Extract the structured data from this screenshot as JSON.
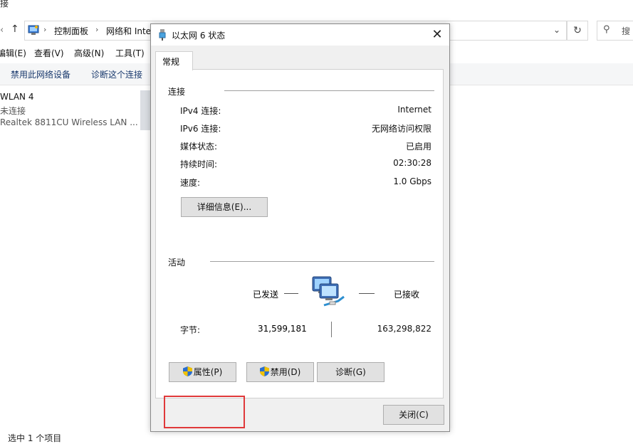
{
  "explorer": {
    "title_fragment": "接",
    "breadcrumb": [
      "控制面板",
      "网络和 Inte"
    ],
    "search_placeholder": "搜",
    "menu": [
      "编辑(E)",
      "查看(V)",
      "高级(N)",
      "工具(T)"
    ],
    "commands": [
      "禁用此网络设备",
      "诊断这个连接"
    ],
    "adapter": {
      "name": "WLAN 4",
      "status": "未连接",
      "description": "Realtek 8811CU Wireless LAN ..."
    },
    "status_bar": "选中 1 个项目"
  },
  "dialog": {
    "title": "以太网 6 状态",
    "tab": "常规",
    "connection": {
      "label": "连接",
      "rows": [
        {
          "label": "IPv4 连接:",
          "value": "Internet"
        },
        {
          "label": "IPv6 连接:",
          "value": "无网络访问权限"
        },
        {
          "label": "媒体状态:",
          "value": "已启用"
        },
        {
          "label": "持续时间:",
          "value": "02:30:28"
        },
        {
          "label": "速度:",
          "value": "1.0 Gbps"
        }
      ],
      "details_button": "详细信息(E)..."
    },
    "activity": {
      "label": "活动",
      "sent_label": "已发送",
      "received_label": "已接收",
      "bytes_label": "字节:",
      "bytes_sent": "31,599,181",
      "bytes_received": "163,298,822"
    },
    "buttons": {
      "properties": "属性(P)",
      "disable": "禁用(D)",
      "diagnose": "诊断(G)",
      "close": "关闭(C)"
    }
  },
  "colors": {
    "highlight": "#e0393a",
    "command_text": "#1a3a6e"
  }
}
